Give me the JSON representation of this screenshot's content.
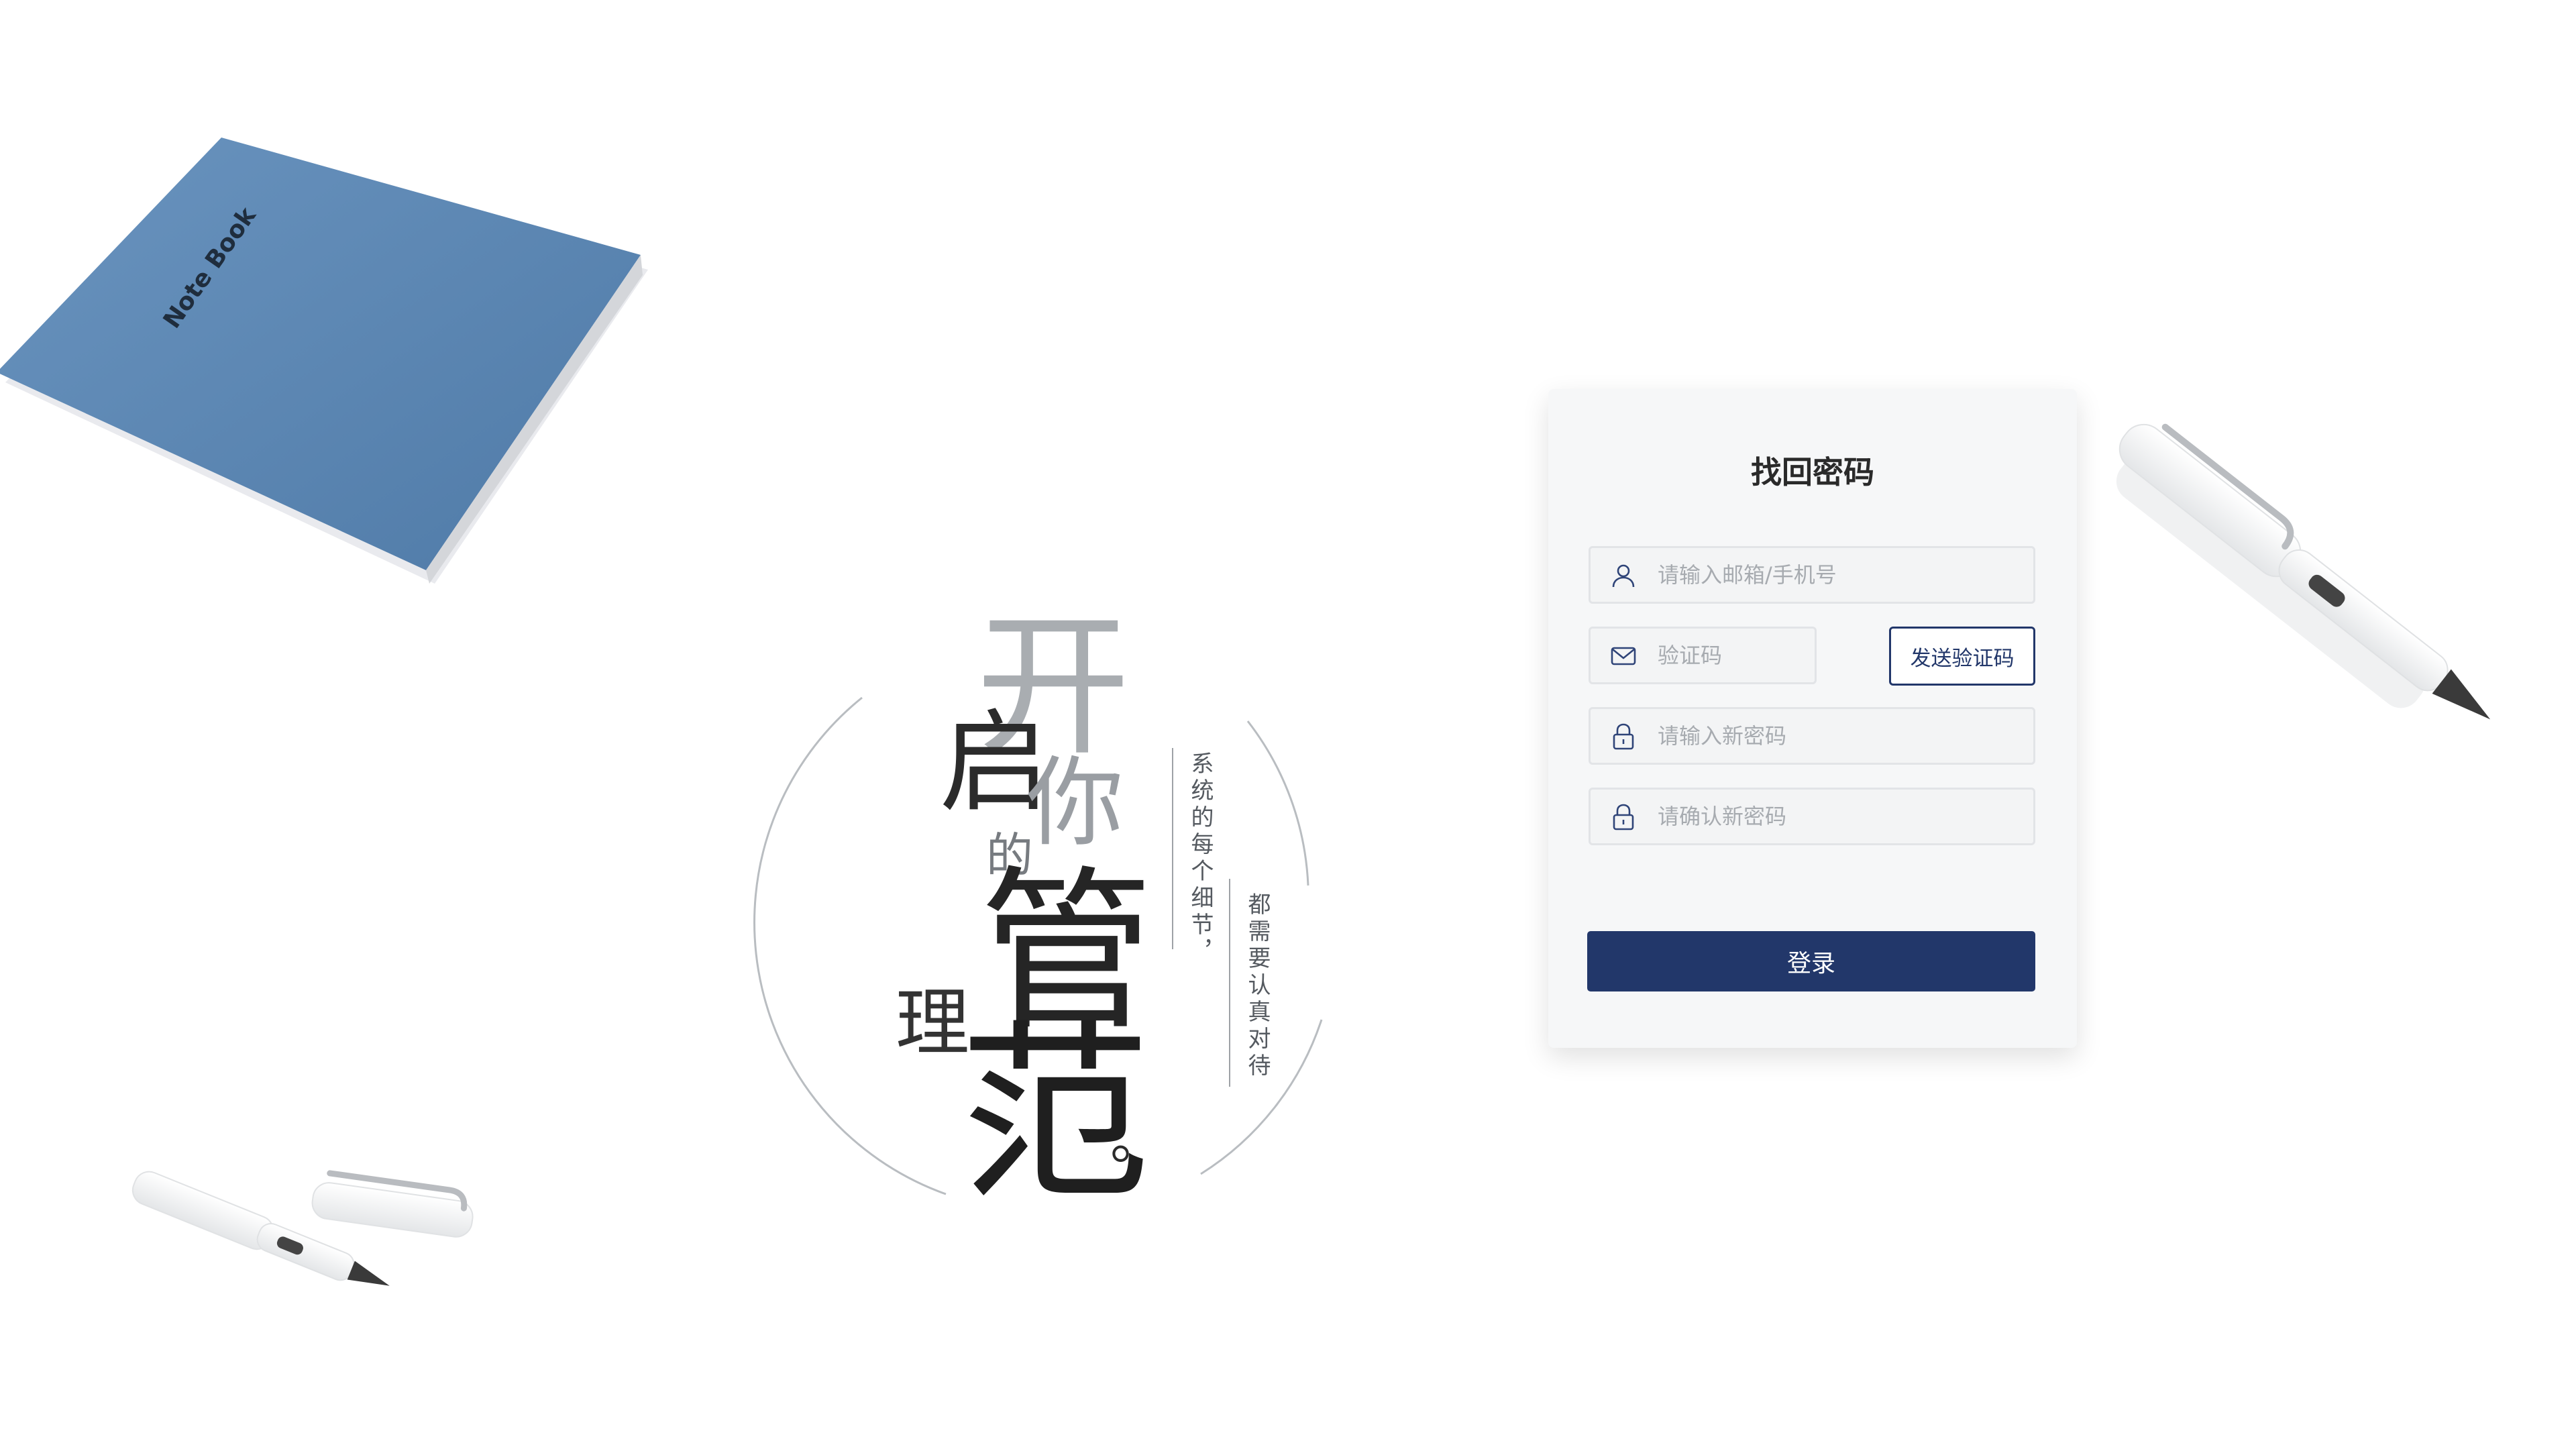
{
  "decor": {
    "notebook_label": "Note Book",
    "notebook_color": "#5b87b5"
  },
  "slogan": {
    "chars": {
      "kai": "开",
      "qi": "启",
      "ni": "你",
      "de": "的",
      "guan": "管",
      "li": "理",
      "fan": "范",
      "end": "。"
    },
    "line1": "系统的每个细节，",
    "line2": "都需要认真对待"
  },
  "form": {
    "title": "找回密码",
    "account_placeholder": "请输入邮箱/手机号",
    "code_placeholder": "验证码",
    "send_code_label": "发送验证码",
    "new_password_placeholder": "请输入新密码",
    "confirm_password_placeholder": "请确认新密码",
    "submit_label": "登录",
    "icons": {
      "account": "user-icon",
      "code": "mail-icon",
      "new_password": "lock-icon",
      "confirm_password": "lock-icon"
    }
  },
  "colors": {
    "primary": "#22376a",
    "card_bg": "#f6f7f8",
    "field_border": "#e2e4e7",
    "placeholder": "#a7abb0"
  }
}
